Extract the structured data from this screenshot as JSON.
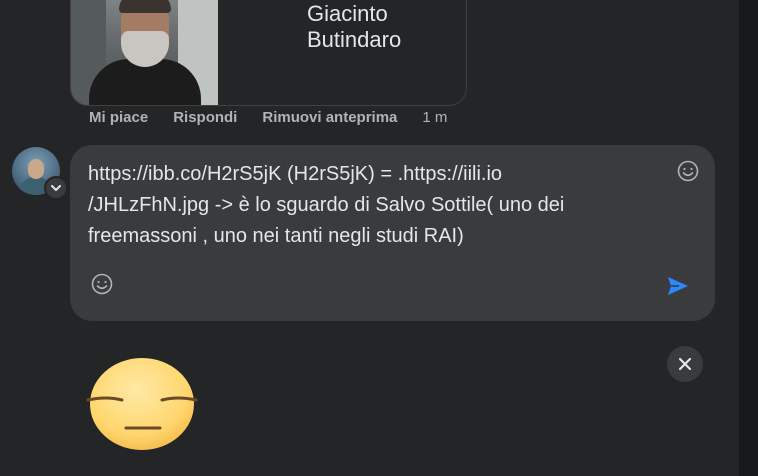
{
  "preview": {
    "name": "Giacinto Butindaro",
    "photo_icon": "person-photo"
  },
  "actions": {
    "like": "Mi piace",
    "reply": "Rispondi",
    "remove_preview": "Rimuovi anteprima",
    "time": "1 m"
  },
  "composer": {
    "text": "https://ibb.co/H2rS5jK (H2rS5jK) = .https://iili.io\n/JHLzFhN.jpg -> è lo sguardo di Salvo Sottile( uno dei\nfreemassoni , uno nei tanti negli studi RAI)",
    "emoji_icon": "smile-icon",
    "send_icon": "send-icon"
  },
  "sticker": {
    "icon": "expressionless-face-sticker",
    "close_icon": "close-icon"
  },
  "colors": {
    "background": "#242526",
    "input": "#3a3b3c",
    "accent": "#2d88ff",
    "sticker_yellow": "#ffd66e"
  }
}
